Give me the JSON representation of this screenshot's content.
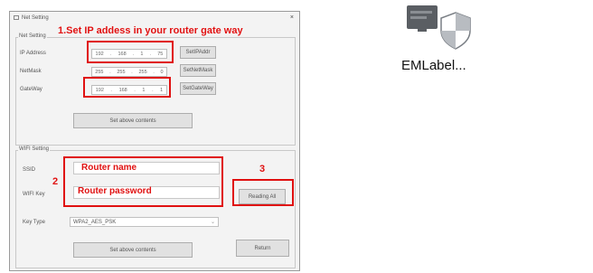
{
  "window": {
    "title": "Net Setting",
    "close_glyph": "×"
  },
  "net_setting": {
    "group_label": "Net Setting",
    "ip_label": "IP Address",
    "netmask_label": "NetMask",
    "gateway_label": "GateWay",
    "ip": [
      "192",
      "168",
      "1",
      "75"
    ],
    "netmask": [
      "255",
      "255",
      "255",
      "0"
    ],
    "gateway": [
      "192",
      "168",
      "1",
      "1"
    ],
    "set_ip_button": "SetIPAddr",
    "set_netmask_button": "SetNetMask",
    "set_gateway_button": "SetGateWay",
    "set_above_button": "Set above contents"
  },
  "wifi_setting": {
    "group_label": "WIFI Setting",
    "ssid_label": "SSID",
    "key_label": "WIFI Key",
    "key_type_label": "Key Type",
    "key_type_value": "WPA2_AES_PSK",
    "set_above_button": "Set above contents",
    "reading_all_button": "Reading All",
    "return_button": "Return"
  },
  "annotations": {
    "step1": "1.Set IP addess in your router gate way",
    "step2_number": "2",
    "router_name": "Router name",
    "router_password": "Router password",
    "step3_number": "3",
    "color": "#e01010"
  },
  "desktop_icon": {
    "label": "EMLabel...",
    "icon": "app-shield-icon"
  }
}
